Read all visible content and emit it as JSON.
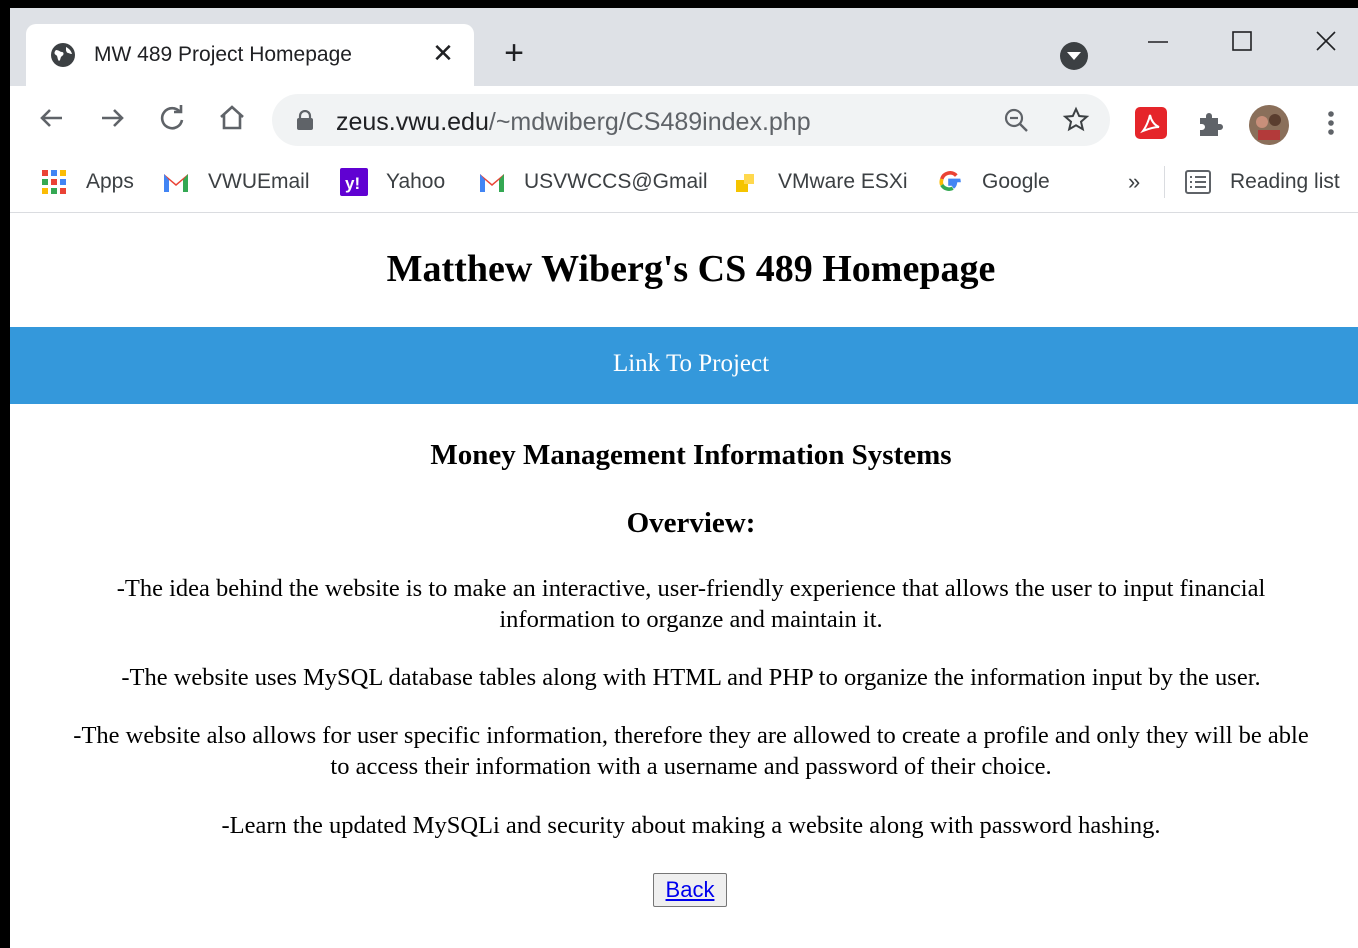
{
  "browser": {
    "tab_title": "MW 489 Project Homepage",
    "new_tab_label": "+",
    "url_domain": "zeus.vwu.edu",
    "url_path": "/~mdwiberg/CS489index.php"
  },
  "bookmarks": [
    {
      "label": "Apps",
      "icon": "apps-grid-icon"
    },
    {
      "label": "VWUEmail",
      "icon": "gmail-icon"
    },
    {
      "label": "Yahoo",
      "icon": "yahoo-icon"
    },
    {
      "label": "USVWCCS@Gmail",
      "icon": "gmail-icon"
    },
    {
      "label": "VMware ESXi",
      "icon": "vmware-icon"
    },
    {
      "label": "Google",
      "icon": "google-icon"
    }
  ],
  "bookmarks_overflow": "»",
  "reading_list": "Reading list",
  "page": {
    "heading": "Matthew Wiberg's CS 489 Homepage",
    "project_link": "Link To Project",
    "subtitle": "Money Management Information Systems",
    "overview_heading": "Overview:",
    "para1_line1": "-The idea behind the website is to make an interactive, user-friendly experience that allows the user to input financial",
    "para1_line2": "information to organze and maintain it.",
    "para2": "-The website uses MySQL database tables along with HTML and PHP to organize the information input by the user.",
    "para3_line1": "-The website also allows for user specific information, therefore they are allowed to create a profile and only they will be able",
    "para3_line2": "to access their information with a username and password of their choice.",
    "para4": "-Learn the updated MySQLi and security about making a website along with password hashing.",
    "back_button": "Back"
  },
  "colors": {
    "banner": "#3498db",
    "tabstrip": "#dee1e6"
  }
}
